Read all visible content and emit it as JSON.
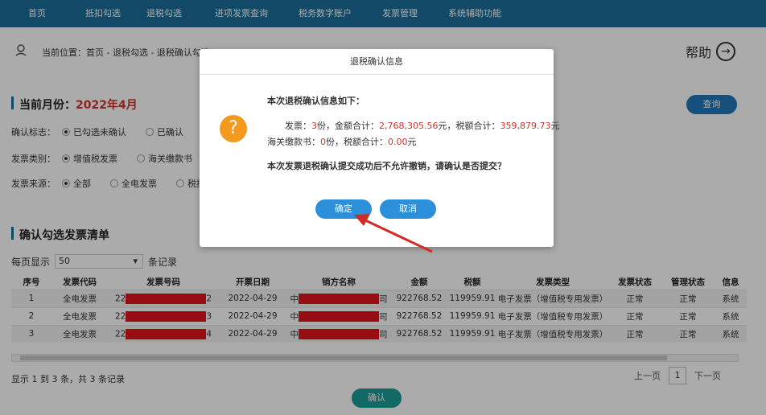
{
  "nav": {
    "items": [
      "首页",
      "抵扣勾选",
      "退税勾选",
      "进项发票查询",
      "税务数字账户",
      "发票管理",
      "系统辅助功能"
    ]
  },
  "breadcrumb": {
    "text": "当前位置：首页 - 退税勾选 - 退税确认勾选",
    "help": "帮助"
  },
  "filter": {
    "section_label": "当前月份：",
    "month": "2022年4月",
    "query_button": "查询",
    "confirm_flag_label": "确认标志：",
    "confirm_flag_options": [
      "已勾选未确认",
      "已确认"
    ],
    "invoice_type_label": "发票类别：",
    "invoice_type_options": [
      "增值税发票",
      "海关缴款书"
    ],
    "source_label": "发票来源：",
    "source_options": [
      "全部",
      "全电发票",
      "税控"
    ]
  },
  "list": {
    "section_label": "确认勾选发票清单",
    "per_page_label": "每页显示",
    "per_page_value": "50",
    "per_page_suffix": "条记录",
    "columns": [
      "序号",
      "发票代码",
      "发票号码",
      "开票日期",
      "销方名称",
      "金额",
      "税额",
      "发票类型",
      "发票状态",
      "管理状态",
      "信息"
    ],
    "rows": [
      {
        "seq": "1",
        "code": "全电发票",
        "num_pre": "22",
        "num_suf": "2",
        "date": "2022-04-29",
        "seller_pre": "中",
        "seller_suf": "司",
        "amount": "922768.52",
        "tax": "119959.91",
        "type": "电子发票（增值税专用发票）",
        "status": "正常",
        "mgmt": "正常",
        "info": "系统"
      },
      {
        "seq": "2",
        "code": "全电发票",
        "num_pre": "22",
        "num_suf": "3",
        "date": "2022-04-29",
        "seller_pre": "中",
        "seller_suf": "司",
        "amount": "922768.52",
        "tax": "119959.91",
        "type": "电子发票（增值税专用发票）",
        "status": "正常",
        "mgmt": "正常",
        "info": "系统"
      },
      {
        "seq": "3",
        "code": "全电发票",
        "num_pre": "22",
        "num_suf": "4",
        "date": "2022-04-29",
        "seller_pre": "中",
        "seller_suf": "司",
        "amount": "922768.52",
        "tax": "119959.91",
        "type": "电子发票（增值税专用发票）",
        "status": "正常",
        "mgmt": "正常",
        "info": "系统"
      }
    ],
    "summary": "显示 1 到 3 条，共 3 条记录",
    "prev": "上一页",
    "page": "1",
    "next": "下一页",
    "confirm_button": "确认"
  },
  "dialog": {
    "title": "退税确认信息",
    "heading": "本次退税确认信息如下：",
    "line1_a": "发票：",
    "line1_count": "3",
    "line1_b": "份，金额合计：",
    "line1_amount": "2,768,305.56",
    "line1_c": "元，税额合计：",
    "line1_tax": "359,879.73",
    "line1_d": "元",
    "line2_a": "海关缴款书：",
    "line2_count": "0",
    "line2_b": "份，税额合计：",
    "line2_tax": "0.00",
    "line2_c": "元",
    "warning": "本次发票退税确认提交成功后不允许撤销，请确认是否提交？",
    "ok": "确定",
    "cancel": "取消"
  },
  "colors": {
    "nav_bg": "#1c6e98",
    "accent_red": "#d0342c",
    "dialog_button": "#2b8fd9",
    "confirm_button": "#1a9b96",
    "question_icon": "#f39a1e",
    "arrow": "#d42a24"
  }
}
